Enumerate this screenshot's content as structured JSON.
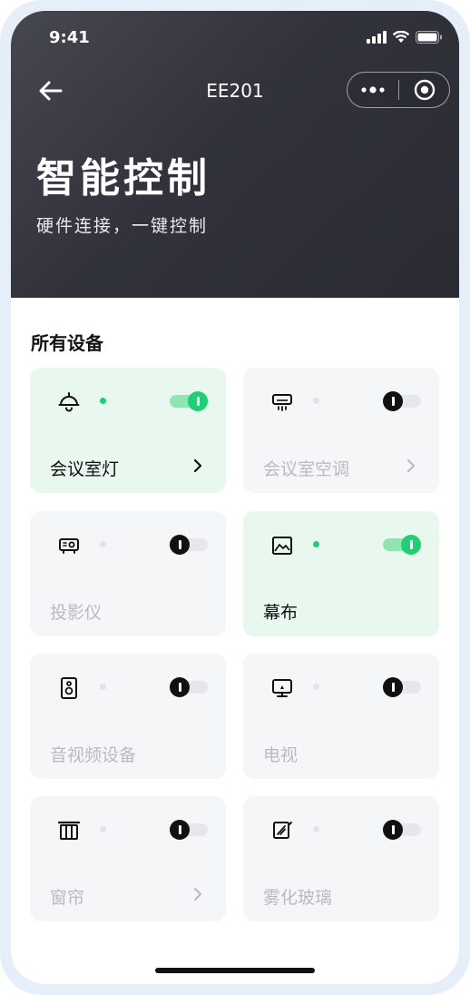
{
  "status_bar": {
    "time": "9:41"
  },
  "nav": {
    "title": "EE201"
  },
  "hero": {
    "title": "智能控制",
    "subtitle": "硬件连接，一键控制"
  },
  "section": {
    "title": "所有设备"
  },
  "devices": [
    {
      "name": "会议室灯",
      "icon": "lamp-icon",
      "on": true,
      "chevron": true
    },
    {
      "name": "会议室空调",
      "icon": "air-conditioner-icon",
      "on": false,
      "chevron": true
    },
    {
      "name": "投影仪",
      "icon": "projector-icon",
      "on": false,
      "chevron": false
    },
    {
      "name": "幕布",
      "icon": "screen-icon",
      "on": true,
      "chevron": false
    },
    {
      "name": "音视频设备",
      "icon": "speaker-icon",
      "on": false,
      "chevron": false
    },
    {
      "name": "电视",
      "icon": "tv-icon",
      "on": false,
      "chevron": false
    },
    {
      "name": "窗帘",
      "icon": "curtain-icon",
      "on": false,
      "chevron": true
    },
    {
      "name": "雾化玻璃",
      "icon": "glass-icon",
      "on": false,
      "chevron": false
    }
  ],
  "colors": {
    "accent": "#1fcf74",
    "header_bg": "#2f3038",
    "card_on_bg": "#e8f8ef",
    "card_off_bg": "#f5f6f8"
  }
}
